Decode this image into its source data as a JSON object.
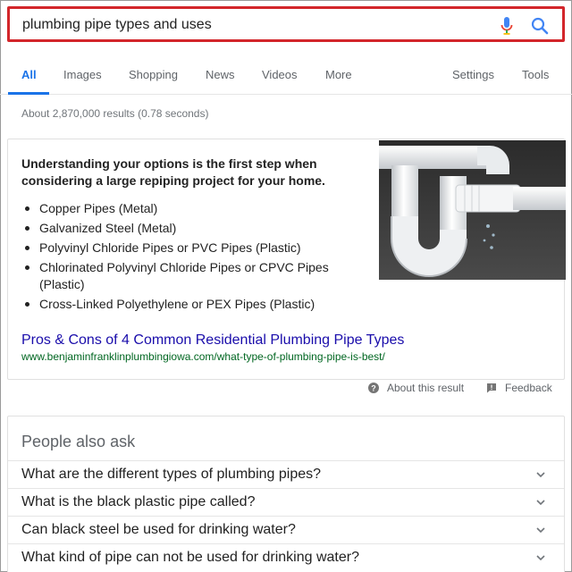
{
  "search": {
    "query": "plumbing pipe types and uses",
    "highlight_color": "#d3262b"
  },
  "tabs": {
    "items": [
      "All",
      "Images",
      "Shopping",
      "News",
      "Videos",
      "More"
    ],
    "settings": "Settings",
    "tools": "Tools",
    "active": "All",
    "accent": "#1a73e8"
  },
  "stats": "About 2,870,000 results (0.78 seconds)",
  "snippet": {
    "heading": "Understanding your options is the first step when considering a large repiping project for your home.",
    "list": [
      "Copper Pipes (Metal)",
      "Galvanized Steel (Metal)",
      "Polyvinyl Chloride Pipes or PVC Pipes (Plastic)",
      "Chlorinated Polyvinyl Chloride Pipes or CPVC Pipes (Plastic)",
      "Cross-Linked Polyethylene or PEX Pipes (Plastic)"
    ],
    "link_title": "Pros & Cons of 4 Common Residential Plumbing Pipe Types",
    "url": "www.benjaminfranklinplumbingiowa.com/what-type-of-plumbing-pipe-is-best/",
    "image": "white-pvc-pipe-trap-photo"
  },
  "about": {
    "about_label": "About this result",
    "feedback_label": "Feedback"
  },
  "paa": {
    "title": "People also ask",
    "questions": [
      "What are the different types of plumbing pipes?",
      "What is the black plastic pipe called?",
      "Can black steel be used for drinking water?",
      "What kind of pipe can not be used for drinking water?"
    ]
  }
}
